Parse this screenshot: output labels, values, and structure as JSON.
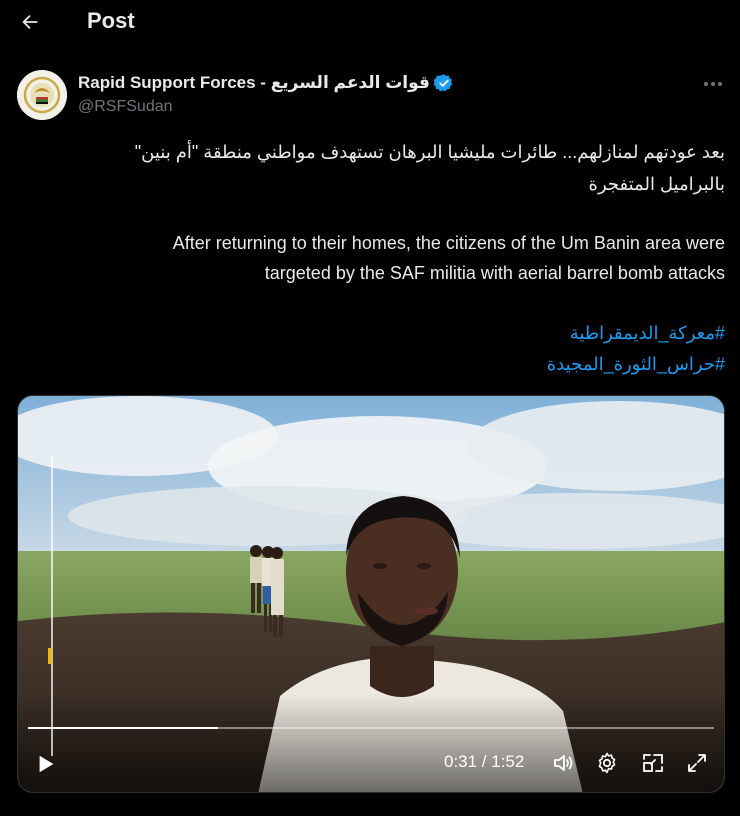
{
  "header": {
    "title": "Post"
  },
  "post": {
    "author_name": "Rapid Support Forces - قوات الدعم السريع",
    "handle": "@RSFSudan",
    "text_ar_line1": "بعد عودتهم لمنازلهم... طائرات مليشيا البرهان تستهدف مواطني منطقة \"أم بنين\"",
    "text_ar_line2": "بالبراميل المتفجرة",
    "text_en_line1": "After returning to their homes, the citizens of the Um Banin area were",
    "text_en_line2": "targeted by the SAF militia with aerial barrel bomb attacks",
    "hashtags": [
      "#معركة_الديمقراطية",
      "#حراس_الثورة_المجيدة"
    ]
  },
  "video": {
    "time_display": "0:31 / 1:52",
    "progress_fraction": 0.277
  },
  "colors": {
    "background": "#000000",
    "text": "#e7e9ea",
    "muted": "#71767b",
    "accent": "#1d9bf0"
  },
  "icons": {
    "back": "arrow-left-icon",
    "verified": "verified-badge-icon",
    "more": "more-icon",
    "play": "play-icon",
    "volume": "volume-icon",
    "settings": "settings-icon",
    "pip": "picture-in-picture-icon",
    "fullscreen": "fullscreen-icon"
  }
}
